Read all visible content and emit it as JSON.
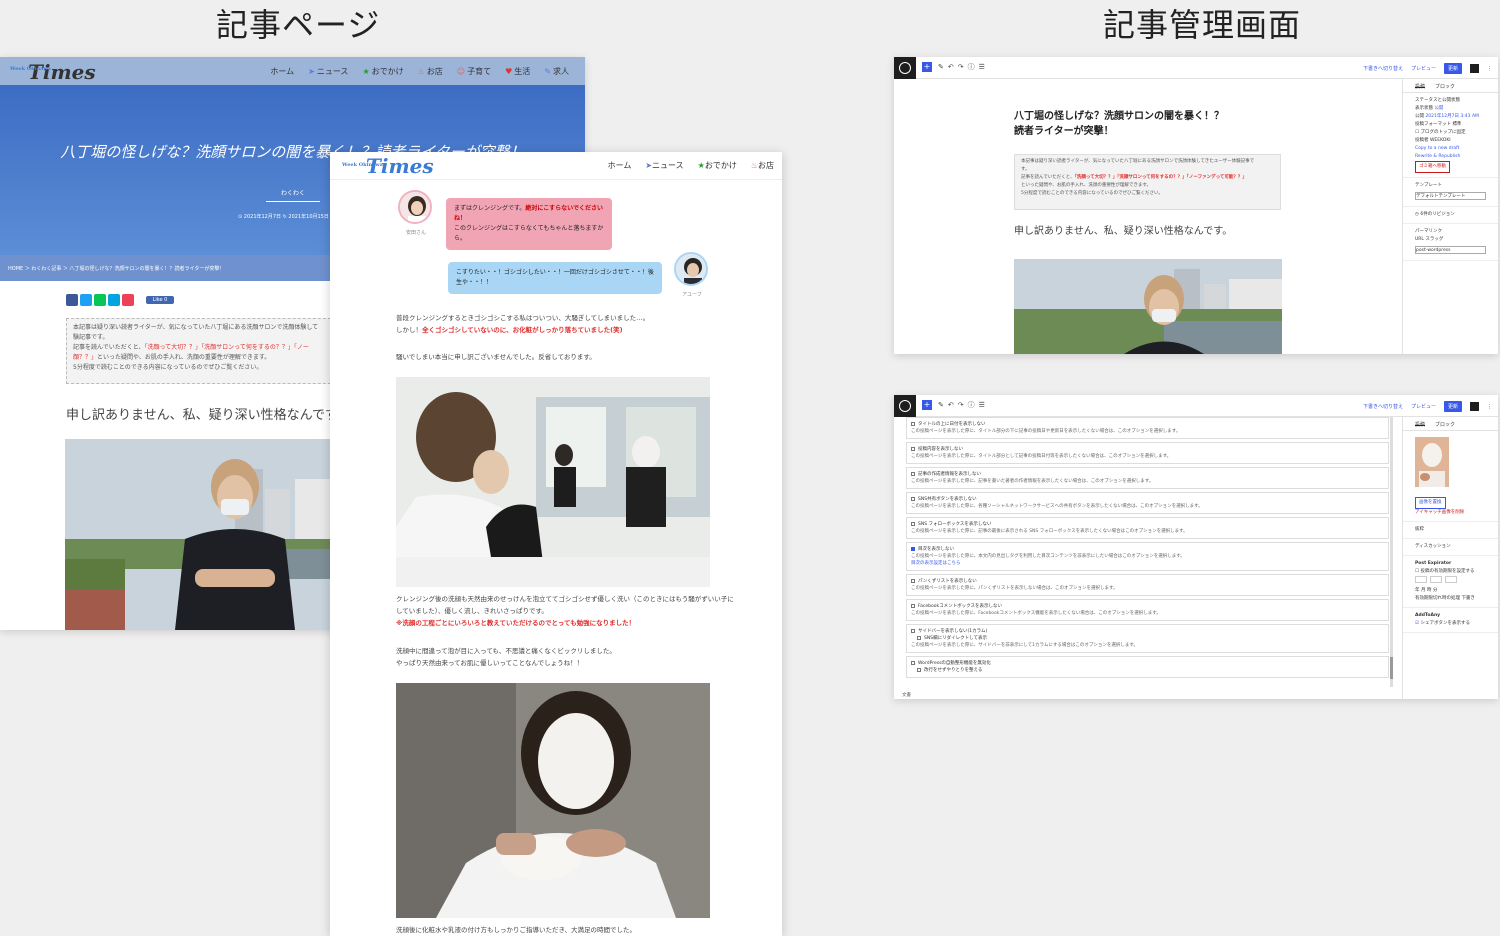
{
  "headings": {
    "article_page": "記事ページ",
    "admin_page": "記事管理画面"
  },
  "site": {
    "logo": "Times",
    "logo_sub": "Week Okinawa",
    "nav": [
      "ホーム",
      "ニュース",
      "おでかけ",
      "お店",
      "子育て",
      "生活",
      "求人"
    ],
    "nav_front": [
      "ホーム",
      "ニュース",
      "おでかけ",
      "お店"
    ]
  },
  "article": {
    "title": "八丁堀の怪しげな？洗顔サロンの闇を暴く！？読者ライターが突撃！",
    "category": "わくわく",
    "date": "⊙ 2021年12月7日 ↻ 2021年10月15日",
    "breadcrumb": "HOME ＞ わくわく記事 ＞ 八丁堀の怪しげな？洗顔サロンの闇を暴く！？読者ライターが突撃！",
    "like_label": "Like 0",
    "intro_lines": [
      "本記事は疑り深い読者ライターが、気になっていた八丁堀にある洗顔サロンで洗顔体験して",
      "験記事です。",
      "記事を読んでいただくと、"
    ],
    "intro_red_1": "「洗顔って大切？？」「洗顔サロンって何をするの？？」「ノー",
    "intro_red_2": "顔？？」",
    "intro_line_end": "といった疑問や、お肌の手入れ、洗顔の重要性が理解できます。",
    "intro_line_last": "5分程度で読むことのできる内容になっているのでぜひご覧ください。",
    "lead": "申し訳ありません、私、疑り深い性格なんです。"
  },
  "chat": {
    "left_name": "安田さん",
    "left_line1_a": "まずはクレンジングです。",
    "left_line1_b": "絶対にこすらないでくださいね！",
    "left_line2": "このクレンジングはこすらなくてもちゃんと落ちますから。",
    "right_name": "アユーブ",
    "right_line": "こすりたい・・！ゴシゴシしたい・・！一回だけゴシゴシさせて・・！後生や・・！！"
  },
  "body": {
    "p1": "普段クレンジングするときゴシゴシこする私はついつい、大騒ぎしてしまいました…。",
    "p1_b": "しかし！",
    "p1_red": "全くゴシゴシしていないのに、お化粧がしっかり落ちていました(笑)",
    "p2": "騒いでしまい本当に申し訳ございませんでした。反省しております。",
    "p3": "クレンジング後の洗顔も天然由来のせっけんを泡立ててゴシゴシせず優しく洗い（このときにはもう騒がずいい子に",
    "p3_b": "していました）、優しく流し、きれいさっぱりです。",
    "p3_red": "※洗顔の工程ごとにいろいろと教えていただけるのでとっても勉強になりました！",
    "p4": "洗顔中に間違って泡が目に入っても、不思議と痛くなくビックリしました。",
    "p4_b": "やっぱり天然由来ってお肌に優しいってことなんでしょうね！！",
    "p5": "洗顔後に化粧水や乳液の付け方もしっかりご指導いただき、大満足の時間でした。"
  },
  "admin": {
    "draft_label": "下書きへ切り替え",
    "preview_label": "プレビュー",
    "publish_label": "更新",
    "tab_post": "投稿",
    "tab_block": "ブロック",
    "title_line1": "八丁堀の怪しげな？洗顔サロンの闇を暴く！？",
    "title_line2": "読者ライターが突撃！",
    "box_lines": [
      "本記事は疑り深い読者ライターが、気になっていた八丁堀にある洗顔サロンで洗顔体験してきたユーザー体験記事で",
      "す。",
      "記事を読んでいただくと、"
    ],
    "box_red": "「洗顔って大切？？」「洗顔サロンって何をするの？？」「ノーファンデって可能？？」",
    "box_line_end": "といった疑問や、お肌の手入れ、洗顔の重要性が理解できます。",
    "box_line_last": "5分程度で読むことのできる内容になっているのでぜひご覧ください。",
    "lead": "申し訳ありません、私、疑り深い性格なんです。",
    "sidebar": {
      "status_head": "ステータスと公開状態",
      "visibility": "表示状態",
      "visibility_val": "公開",
      "publish": "公開",
      "publish_val": "2021年12月7日 3:43 AM",
      "format": "投稿フォーマット",
      "format_val": "標準",
      "sticky": "ブログのトップに固定",
      "author": "投稿者",
      "author_val": "WEEKOKI",
      "move_trash": "ゴミ箱へ移動",
      "revisions": "6件のリビジョン",
      "template_head": "テンプレート",
      "template_val": "デフォルトテンプレート",
      "permalink_head": "パーマリンク",
      "url_slug": "URL スラッグ",
      "slug_val": "post-wordpress",
      "link1": "Copy to a new draft",
      "link2": "Rewrite & Republish"
    },
    "options": [
      {
        "label": "タイトルの上に日付を表示しない",
        "desc": "この投稿ページを表示した際に、タイトル部分の下に記事の投稿日や更新日を表示したくない場合は、このオプションを選択します。",
        "checked": false
      },
      {
        "label": "投稿内容を表示しない",
        "desc": "この投稿ページを表示した際に、タイトル部分として記事の投稿日付等を表示したくない場合は、このオプションを選択します。",
        "checked": false
      },
      {
        "label": "記事の作成者情報を表示しない",
        "desc": "この投稿ページを表示した際に、記事を書いた著者の作者情報を表示したくない場合は、このオプションを選択します。",
        "checked": false
      },
      {
        "label": "SNS共有ボタンを表示しない",
        "desc": "この投稿ページを表示した際に、各種ソーシャルネットワークサービスへの共有ボタンを表示したくない場合は、このオプションを選択します。",
        "checked": false
      },
      {
        "label": "SNS フォローボックスを表示しない",
        "desc": "この投稿ページを表示した際に、記事の最後に表示される SNS フォローボックスを表示したくない場合はこのオプションを選択します。",
        "checked": false
      },
      {
        "label": "目次を表示しない",
        "desc": "この投稿ページを表示した際に、本文内の見出しタグを利用した目次コンテンツを非表示にしたい場合はこのオプションを選択します。",
        "link": "目次の表示設定はこちら",
        "checked": true
      },
      {
        "label": "パンくずリストを表示しない",
        "desc": "この投稿ページを表示した際に、パンくずリストを表示しない場合は、このオプションを選択します。",
        "checked": false
      },
      {
        "label": "Facebookコメントボックスを表示しない",
        "desc": "この投稿ページを表示した際に、Facebookコメントボックス機能を表示したくない場合は、このオプションを選択します。",
        "checked": false
      },
      {
        "label": "サイドバーを表示しない(1カラム)",
        "sub": "SNS欄にリダイレクトして表示",
        "desc": "この投稿ページを表示した際に、サイドバーを非表示にして1カラムにする場合はこのオプションを選択します。",
        "checked": false
      },
      {
        "label": "WordPressの自動整形機能を無効化",
        "sub": "改行をせずやりとりを整える",
        "desc": "",
        "checked": false
      }
    ],
    "footer": "文書",
    "sidebar_d": {
      "replace": "画像を置換",
      "remove": "アイキャッチ画像を削除",
      "discussion": "ディスカッション",
      "excerpt": "抜粋",
      "post_expirator": "Post Expirator",
      "enable_expire": "投稿の有効期限を設定する",
      "year": "年",
      "month": "月",
      "hour": "時",
      "minute": "分",
      "action": "有効期限切れ時の処理",
      "action_val": "下書き",
      "addtoany": "AddToAny",
      "share_buttons": "シェアボタンを表示する"
    }
  },
  "colors": {
    "accent": "#3858e9",
    "hero": "#3d6cc4",
    "red_text": "#e02d2d",
    "pink_bubble": "#f0a4b4",
    "blue_bubble": "#a9d6f5"
  }
}
